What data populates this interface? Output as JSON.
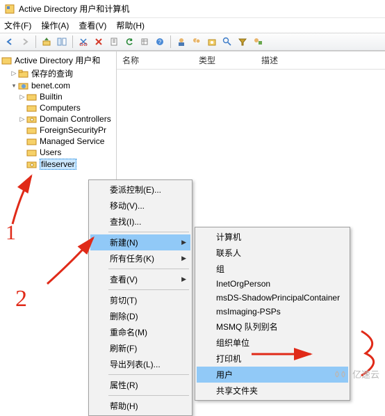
{
  "window": {
    "title": "Active Directory 用户和计算机"
  },
  "menubar": {
    "file": "文件(F)",
    "action": "操作(A)",
    "view": "查看(V)",
    "help": "帮助(H)"
  },
  "list_columns": {
    "name": "名称",
    "type": "类型",
    "desc": "描述"
  },
  "tree": {
    "root": "Active Directory 用户和",
    "saved_queries": "保存的查询",
    "domain": "benet.com",
    "nodes": {
      "builtin": "Builtin",
      "computers": "Computers",
      "domain_controllers": "Domain Controllers",
      "foreign_sp": "ForeignSecurityPr",
      "managed_svc": "Managed Service",
      "users": "Users",
      "fileserver": "fileserver"
    }
  },
  "context_menu": {
    "delegate": "委派控制(E)...",
    "move": "移动(V)...",
    "find": "查找(I)...",
    "new": "新建(N)",
    "all_tasks": "所有任务(K)",
    "view": "查看(V)",
    "cut": "剪切(T)",
    "delete": "删除(D)",
    "rename": "重命名(M)",
    "refresh": "刷新(F)",
    "export": "导出列表(L)...",
    "properties": "属性(R)",
    "help": "帮助(H)"
  },
  "submenu": {
    "computer": "计算机",
    "contact": "联系人",
    "group": "组",
    "inetorg": "InetOrgPerson",
    "msds_shadow": "msDS-ShadowPrincipalContainer",
    "msimaging": "msImaging-PSPs",
    "msmq": "MSMQ 队列别名",
    "ou": "组织单位",
    "printer": "打印机",
    "user": "用户",
    "shared_folder": "共享文件夹"
  },
  "annotations": {
    "anno1": "1",
    "anno2": "2",
    "anno3": "3"
  },
  "watermark": {
    "text": "亿速云"
  }
}
